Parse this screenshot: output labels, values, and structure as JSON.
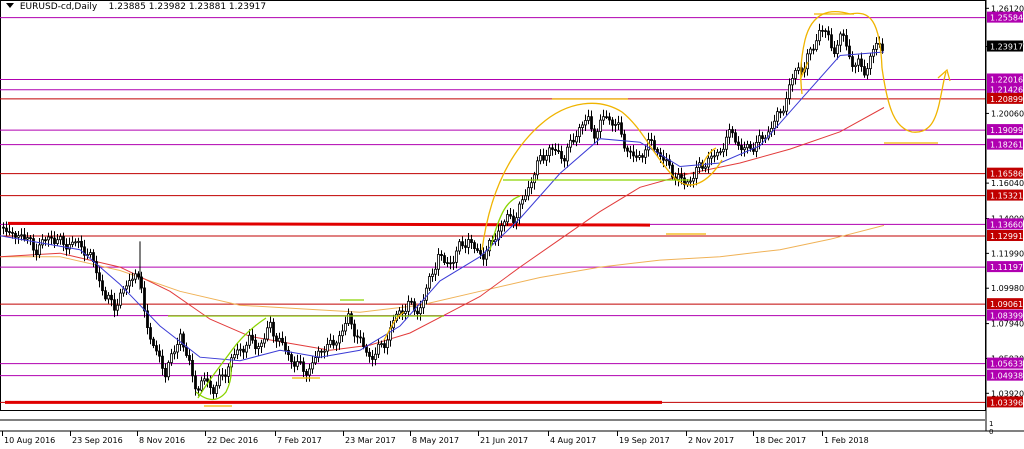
{
  "header": {
    "symbol": "EURUSD-cd,Daily",
    "ohlc": "1.23885 1.23982 1.23881 1.23917"
  },
  "chart_data": {
    "type": "candlestick",
    "symbol": "EURUSD-cd",
    "timeframe": "Daily",
    "ylim": [
      1.029,
      1.266
    ],
    "price_ticks": [
      "1.26120",
      "1.23917",
      "1.20060",
      "1.16040",
      "1.14000",
      "1.11990",
      "1.09980",
      "1.07940",
      "1.05930",
      "1.03920"
    ],
    "date_ticks": [
      "10 Aug 2016",
      "23 Sep 2016",
      "8 Nov 2016",
      "22 Dec 2016",
      "7 Feb 2017",
      "23 Mar 2017",
      "8 May 2017",
      "21 Jun 2017",
      "4 Aug 2017",
      "19 Sep 2017",
      "2 Nov 2017",
      "18 Dec 2017",
      "1 Feb 2018"
    ],
    "current_price": {
      "label": "1.23917",
      "value": 1.23917,
      "color": "#000000"
    },
    "levels": [
      {
        "label": "1.25584",
        "value": 1.25584,
        "color": "#b000b0"
      },
      {
        "label": "1.22016",
        "value": 1.22016,
        "color": "#b000b0"
      },
      {
        "label": "1.21426",
        "value": 1.21426,
        "color": "#b000b0"
      },
      {
        "label": "1.20899",
        "value": 1.20899,
        "color": "#c00000"
      },
      {
        "label": "1.19099",
        "value": 1.19099,
        "color": "#b000b0"
      },
      {
        "label": "1.18261",
        "value": 1.18261,
        "color": "#b000b0"
      },
      {
        "label": "1.16586",
        "value": 1.16586,
        "color": "#c00000"
      },
      {
        "label": "1.15321",
        "value": 1.15321,
        "color": "#c00000"
      },
      {
        "label": "1.13660",
        "value": 1.1366,
        "color": "#b000b0"
      },
      {
        "label": "1.12991",
        "value": 1.12991,
        "color": "#c00000"
      },
      {
        "label": "1.11197",
        "value": 1.11197,
        "color": "#b000b0"
      },
      {
        "label": "1.09061",
        "value": 1.09061,
        "color": "#c00000"
      },
      {
        "label": "1.08399",
        "value": 1.08399,
        "color": "#b000b0"
      },
      {
        "label": "1.05633",
        "value": 1.05633,
        "color": "#b000b0"
      },
      {
        "label": "1.04938",
        "value": 1.04938,
        "color": "#b000b0"
      },
      {
        "label": "1.03396",
        "value": 1.03396,
        "color": "#c00000"
      }
    ],
    "price_path": [
      [
        0,
        1.131
      ],
      [
        4,
        1.139
      ],
      [
        10,
        1.128
      ],
      [
        20,
        1.132
      ],
      [
        35,
        1.122
      ],
      [
        50,
        1.13
      ],
      [
        62,
        1.125
      ],
      [
        75,
        1.126
      ],
      [
        85,
        1.122
      ],
      [
        95,
        1.112
      ],
      [
        105,
        1.094
      ],
      [
        115,
        1.09
      ],
      [
        125,
        1.1
      ],
      [
        135,
        1.11
      ],
      [
        142,
        1.095
      ],
      [
        150,
        1.07
      ],
      [
        158,
        1.06
      ],
      [
        165,
        1.052
      ],
      [
        172,
        1.06
      ],
      [
        180,
        1.074
      ],
      [
        186,
        1.06
      ],
      [
        192,
        1.05
      ],
      [
        198,
        1.041
      ],
      [
        205,
        1.048
      ],
      [
        212,
        1.041
      ],
      [
        218,
        1.045
      ],
      [
        225,
        1.052
      ],
      [
        232,
        1.06
      ],
      [
        240,
        1.064
      ],
      [
        248,
        1.07
      ],
      [
        256,
        1.066
      ],
      [
        263,
        1.07
      ],
      [
        270,
        1.078
      ],
      [
        278,
        1.07
      ],
      [
        285,
        1.064
      ],
      [
        292,
        1.058
      ],
      [
        300,
        1.054
      ],
      [
        308,
        1.052
      ],
      [
        316,
        1.06
      ],
      [
        324,
        1.067
      ],
      [
        332,
        1.066
      ],
      [
        340,
        1.074
      ],
      [
        348,
        1.082
      ],
      [
        355,
        1.075
      ],
      [
        362,
        1.066
      ],
      [
        370,
        1.06
      ],
      [
        378,
        1.064
      ],
      [
        386,
        1.07
      ],
      [
        394,
        1.082
      ],
      [
        402,
        1.088
      ],
      [
        410,
        1.09
      ],
      [
        418,
        1.086
      ],
      [
        426,
        1.098
      ],
      [
        432,
        1.11
      ],
      [
        438,
        1.118
      ],
      [
        445,
        1.114
      ],
      [
        452,
        1.116
      ],
      [
        460,
        1.124
      ],
      [
        468,
        1.128
      ],
      [
        476,
        1.12
      ],
      [
        484,
        1.12
      ],
      [
        492,
        1.126
      ],
      [
        500,
        1.136
      ],
      [
        508,
        1.14
      ],
      [
        516,
        1.142
      ],
      [
        524,
        1.152
      ],
      [
        532,
        1.164
      ],
      [
        540,
        1.174
      ],
      [
        548,
        1.18
      ],
      [
        556,
        1.178
      ],
      [
        564,
        1.176
      ],
      [
        572,
        1.184
      ],
      [
        580,
        1.194
      ],
      [
        588,
        1.196
      ],
      [
        596,
        1.188
      ],
      [
        604,
        1.2
      ],
      [
        612,
        1.196
      ],
      [
        620,
        1.19
      ],
      [
        628,
        1.178
      ],
      [
        636,
        1.174
      ],
      [
        644,
        1.18
      ],
      [
        652,
        1.184
      ],
      [
        660,
        1.176
      ],
      [
        668,
        1.17
      ],
      [
        676,
        1.164
      ],
      [
        684,
        1.16
      ],
      [
        692,
        1.164
      ],
      [
        700,
        1.17
      ],
      [
        708,
        1.174
      ],
      [
        716,
        1.176
      ],
      [
        724,
        1.184
      ],
      [
        732,
        1.19
      ],
      [
        740,
        1.18
      ],
      [
        748,
        1.18
      ],
      [
        756,
        1.184
      ],
      [
        764,
        1.186
      ],
      [
        772,
        1.195
      ],
      [
        780,
        1.2
      ],
      [
        788,
        1.214
      ],
      [
        796,
        1.226
      ],
      [
        804,
        1.228
      ],
      [
        812,
        1.238
      ],
      [
        820,
        1.25
      ],
      [
        828,
        1.244
      ],
      [
        836,
        1.236
      ],
      [
        842,
        1.248
      ],
      [
        848,
        1.236
      ],
      [
        854,
        1.226
      ],
      [
        860,
        1.23
      ],
      [
        866,
        1.224
      ],
      [
        872,
        1.236
      ],
      [
        878,
        1.242
      ],
      [
        884,
        1.239
      ]
    ],
    "ma_slow": [
      [
        0,
        1.118
      ],
      [
        60,
        1.118
      ],
      [
        120,
        1.11
      ],
      [
        180,
        1.098
      ],
      [
        240,
        1.09
      ],
      [
        300,
        1.088
      ],
      [
        360,
        1.086
      ],
      [
        420,
        1.09
      ],
      [
        480,
        1.098
      ],
      [
        540,
        1.106
      ],
      [
        600,
        1.112
      ],
      [
        660,
        1.116
      ],
      [
        720,
        1.118
      ],
      [
        780,
        1.122
      ],
      [
        830,
        1.128
      ],
      [
        884,
        1.136
      ]
    ],
    "ma_mid": [
      [
        0,
        1.118
      ],
      [
        60,
        1.12
      ],
      [
        120,
        1.112
      ],
      [
        170,
        1.098
      ],
      [
        210,
        1.082
      ],
      [
        250,
        1.072
      ],
      [
        290,
        1.068
      ],
      [
        330,
        1.064
      ],
      [
        370,
        1.067
      ],
      [
        410,
        1.074
      ],
      [
        450,
        1.086
      ],
      [
        480,
        1.095
      ],
      [
        520,
        1.112
      ],
      [
        560,
        1.128
      ],
      [
        600,
        1.144
      ],
      [
        640,
        1.158
      ],
      [
        690,
        1.166
      ],
      [
        740,
        1.172
      ],
      [
        790,
        1.18
      ],
      [
        840,
        1.19
      ],
      [
        884,
        1.204
      ]
    ],
    "ma_fast": [
      [
        0,
        1.13
      ],
      [
        40,
        1.126
      ],
      [
        80,
        1.122
      ],
      [
        120,
        1.102
      ],
      [
        160,
        1.078
      ],
      [
        200,
        1.06
      ],
      [
        240,
        1.058
      ],
      [
        280,
        1.064
      ],
      [
        320,
        1.06
      ],
      [
        360,
        1.064
      ],
      [
        400,
        1.078
      ],
      [
        440,
        1.104
      ],
      [
        480,
        1.118
      ],
      [
        520,
        1.14
      ],
      [
        560,
        1.166
      ],
      [
        600,
        1.186
      ],
      [
        640,
        1.184
      ],
      [
        680,
        1.17
      ],
      [
        720,
        1.172
      ],
      [
        760,
        1.182
      ],
      [
        800,
        1.208
      ],
      [
        840,
        1.234
      ],
      [
        884,
        1.236
      ]
    ]
  },
  "colors": {
    "up": "#000000",
    "down": "#000000",
    "ma_fast": "#3b3bd6",
    "ma_mid": "#e23b3b",
    "ma_slow": "#f0b257",
    "annotation_yellow": "#f0b400",
    "annotation_green": "#8ad400",
    "resistance": "#e00000"
  }
}
